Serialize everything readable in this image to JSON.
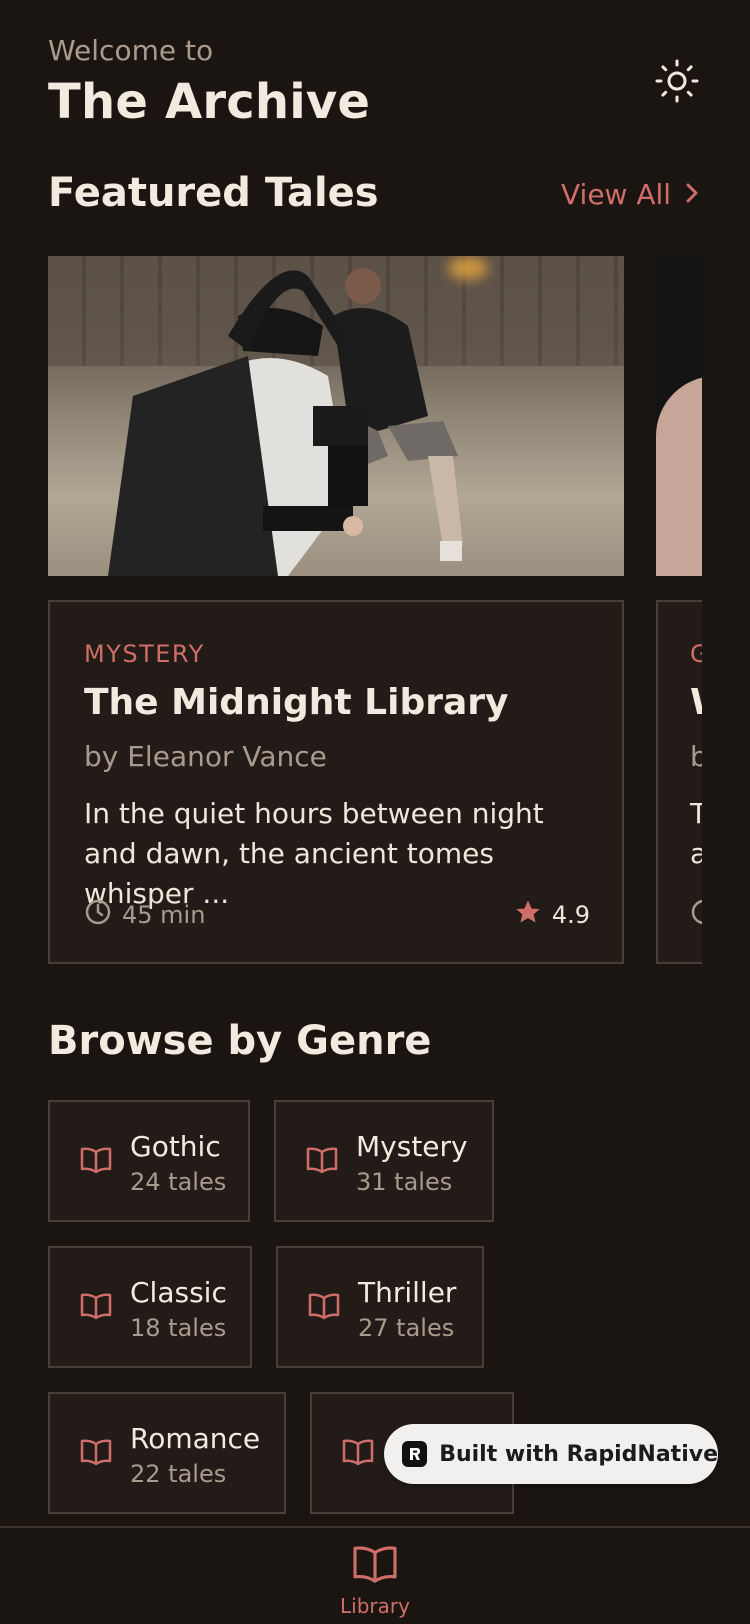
{
  "header": {
    "welcome": "Welcome to",
    "title": "The Archive"
  },
  "featured": {
    "title": "Featured Tales",
    "view_all": "View All",
    "cards": [
      {
        "genre": "MYSTERY",
        "title": "The Midnight Library",
        "author": "by Eleanor Vance",
        "excerpt": "In the quiet hours between night and dawn, the ancient tomes whisper ...",
        "duration": "45 min",
        "rating": "4.9"
      },
      {
        "genre": "G",
        "title": "W",
        "author": "b",
        "excerpt": "T a"
      }
    ]
  },
  "genres": {
    "title": "Browse by Genre",
    "items": [
      {
        "name": "Gothic",
        "count": "24 tales"
      },
      {
        "name": "Mystery",
        "count": "31 tales"
      },
      {
        "name": "Classic",
        "count": "18 tales"
      },
      {
        "name": "Thriller",
        "count": "27 tales"
      },
      {
        "name": "Romance",
        "count": "22 tales"
      },
      {
        "name": "",
        "count": ""
      }
    ]
  },
  "badge": {
    "text": "Built with RapidNative"
  },
  "nav": {
    "library": "Library"
  },
  "colors": {
    "background": "#1b1512",
    "card": "#231b17",
    "accent": "#cf6e69",
    "text": "#f3eadf",
    "muted": "#a89b8d"
  }
}
